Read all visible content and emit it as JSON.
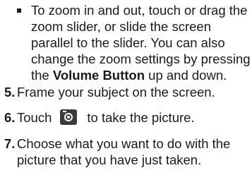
{
  "bullet": {
    "text_before": "To zoom in and out, touch or drag the zoom slider, or slide the screen parallel to the slider. You can also change the zoom settings by pressing the ",
    "bold_text": "Volume Button",
    "text_after": " up and down."
  },
  "steps": [
    {
      "number": "5.",
      "text": "Frame your subject on the screen."
    },
    {
      "number": "6.",
      "text_before_icon": "Touch",
      "icon": "camera-icon",
      "text_after_icon": "to take the picture."
    },
    {
      "number": "7.",
      "text": "Choose what you want to do with the picture that you have just taken."
    }
  ]
}
